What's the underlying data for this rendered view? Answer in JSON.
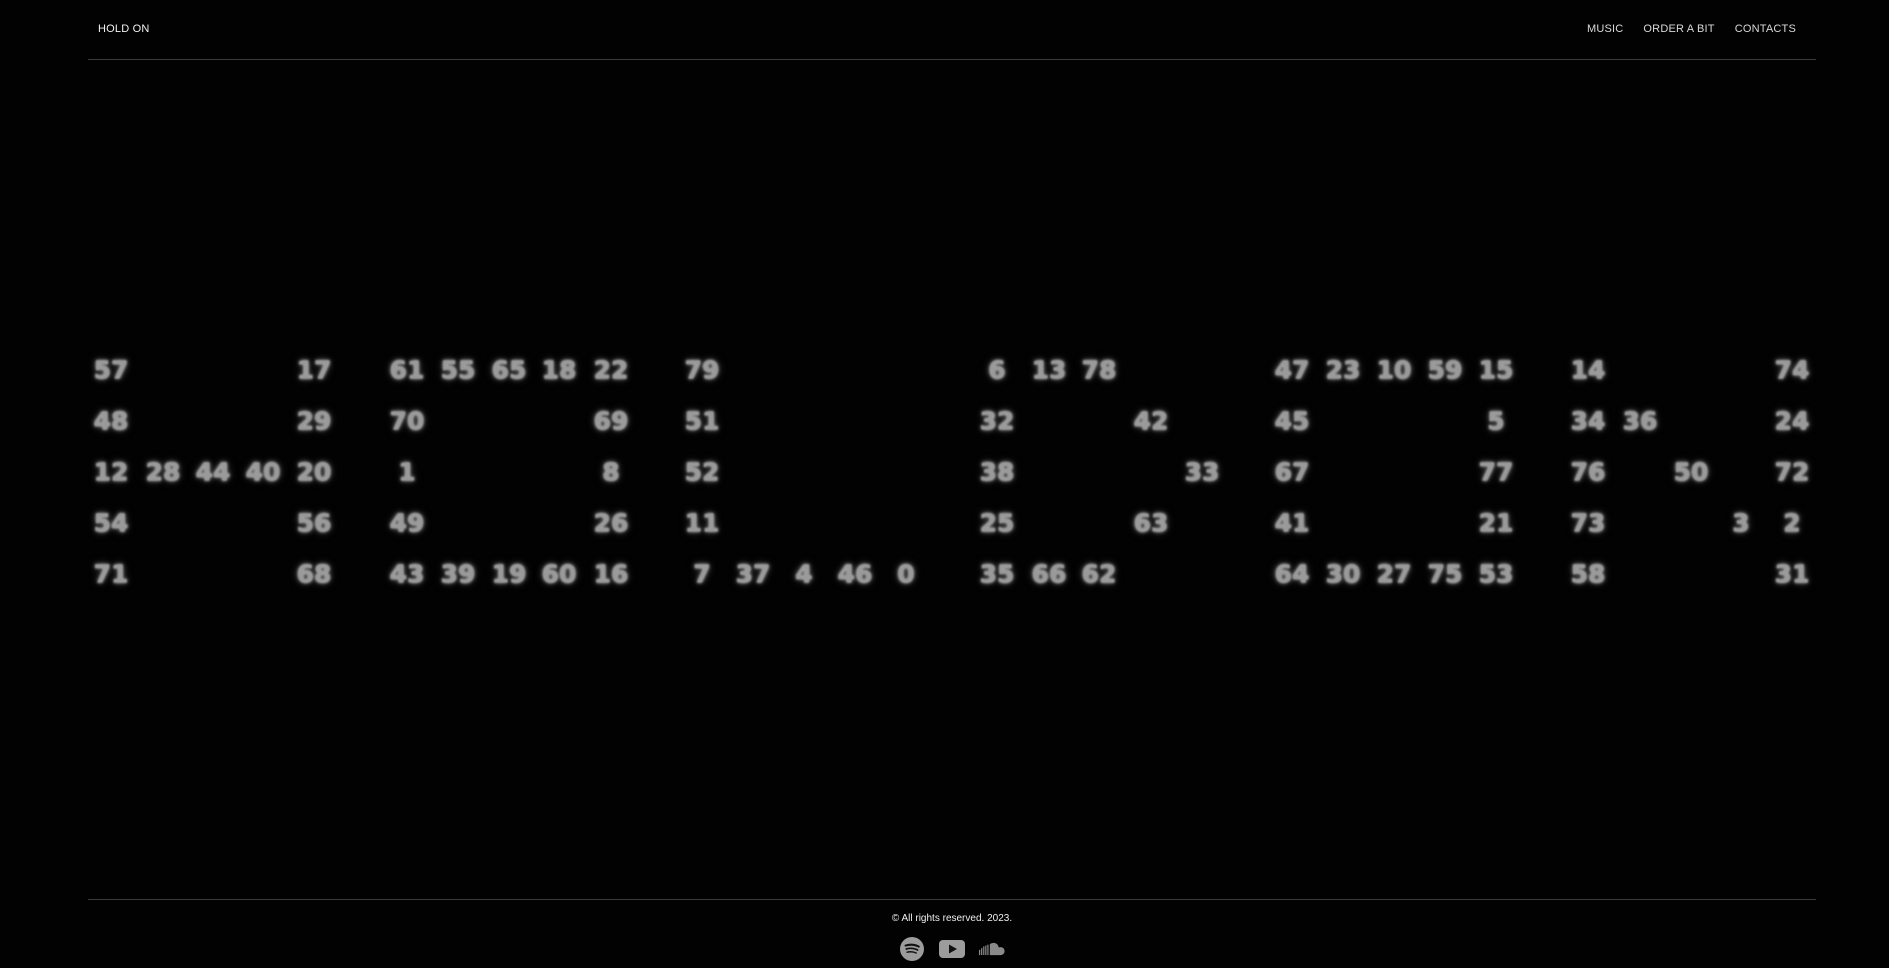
{
  "header": {
    "brand": "HOLD ON",
    "nav": [
      "MUSIC",
      "ORDER A BIT",
      "CONTACTS"
    ]
  },
  "numbers": [
    "57",
    "17",
    "61",
    "55",
    "65",
    "18",
    "22",
    "79",
    "6",
    "13",
    "78",
    "47",
    "23",
    "10",
    "59",
    "15",
    "14",
    "74",
    "48",
    "29",
    "70",
    "69",
    "51",
    "32",
    "42",
    "45",
    "5",
    "34",
    "36",
    "24",
    "12",
    "28",
    "44",
    "40",
    "20",
    "1",
    "8",
    "52",
    "38",
    "33",
    "67",
    "77",
    "76",
    "50",
    "72",
    "54",
    "56",
    "49",
    "26",
    "11",
    "25",
    "63",
    "41",
    "21",
    "73",
    "3",
    "2",
    "71",
    "68",
    "43",
    "39",
    "19",
    "60",
    "16",
    "7",
    "37",
    "4",
    "46",
    "0",
    "35",
    "66",
    "62",
    "64",
    "30",
    "27",
    "75",
    "53",
    "58",
    "31"
  ],
  "footer": {
    "copyright": "© All rights reserved. 2023.",
    "socials": [
      "spotify-icon",
      "youtube-icon",
      "soundcloud-icon"
    ]
  },
  "colors": {
    "background": "#020202",
    "text": "#f2f2f2",
    "number": "#9a9a9a",
    "divider": "#3a3a3a"
  }
}
